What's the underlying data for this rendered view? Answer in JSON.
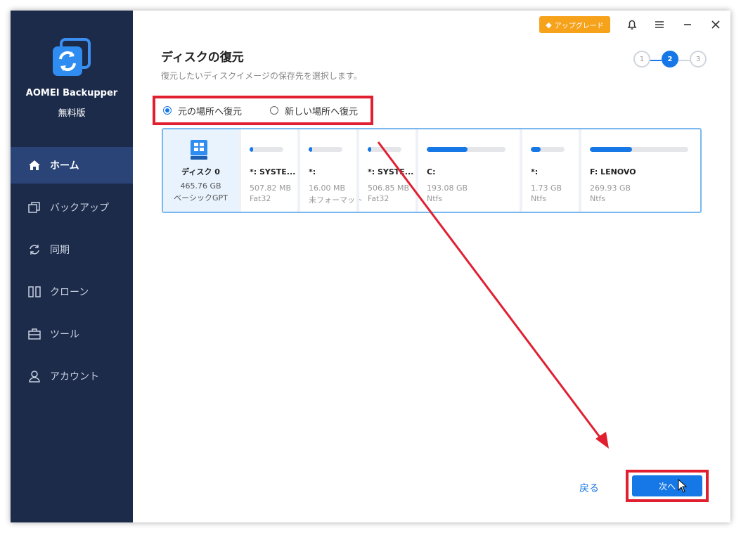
{
  "app": {
    "name": "AOMEI Backupper",
    "edition": "無料版"
  },
  "sidebar": {
    "items": [
      {
        "label": "ホーム",
        "icon": "home-icon",
        "active": true
      },
      {
        "label": "バックアップ",
        "icon": "backup-icon",
        "active": false
      },
      {
        "label": "同期",
        "icon": "sync-icon",
        "active": false
      },
      {
        "label": "クローン",
        "icon": "clone-icon",
        "active": false
      },
      {
        "label": "ツール",
        "icon": "toolbox-icon",
        "active": false
      },
      {
        "label": "アカウント",
        "icon": "user-icon",
        "active": false
      }
    ]
  },
  "topbar": {
    "upgrade_label": "アップグレード"
  },
  "page": {
    "title": "ディスクの復元",
    "subtitle": "復元したいディスクイメージの保存先を選択します。"
  },
  "steps": {
    "labels": [
      "1",
      "2",
      "3"
    ],
    "current": 2
  },
  "restore_options": {
    "original": "元の場所へ復元",
    "new": "新しい場所へ復元",
    "selected": "original"
  },
  "disk": {
    "name": "ディスク 0",
    "size": "465.76 GB",
    "type": "ベーシックGPT"
  },
  "partitions": [
    {
      "name": "*: SYSTE...",
      "size": "507.82 MB",
      "fs": "Fat32",
      "used": 0.04
    },
    {
      "name": "*:",
      "size": "16.00 MB",
      "fs": "未フォーマット",
      "used": 0.04
    },
    {
      "name": "*: SYSTE...",
      "size": "506.85 MB",
      "fs": "Fat32",
      "used": 0.04
    },
    {
      "name": "C:",
      "size": "193.08 GB",
      "fs": "Ntfs",
      "used": 0.52
    },
    {
      "name": "*:",
      "size": "1.73 GB",
      "fs": "Ntfs",
      "used": 0.3
    },
    {
      "name": "F: LENOVO",
      "size": "269.93 GB",
      "fs": "Ntfs",
      "used": 0.43
    }
  ],
  "footer": {
    "back_label": "戻る",
    "next_label": "次へ"
  },
  "colors": {
    "sidebar_bg": "#1c2b4a",
    "accent": "#1677e6",
    "upgrade": "#f7a21b",
    "annotation_red": "#e02030"
  }
}
